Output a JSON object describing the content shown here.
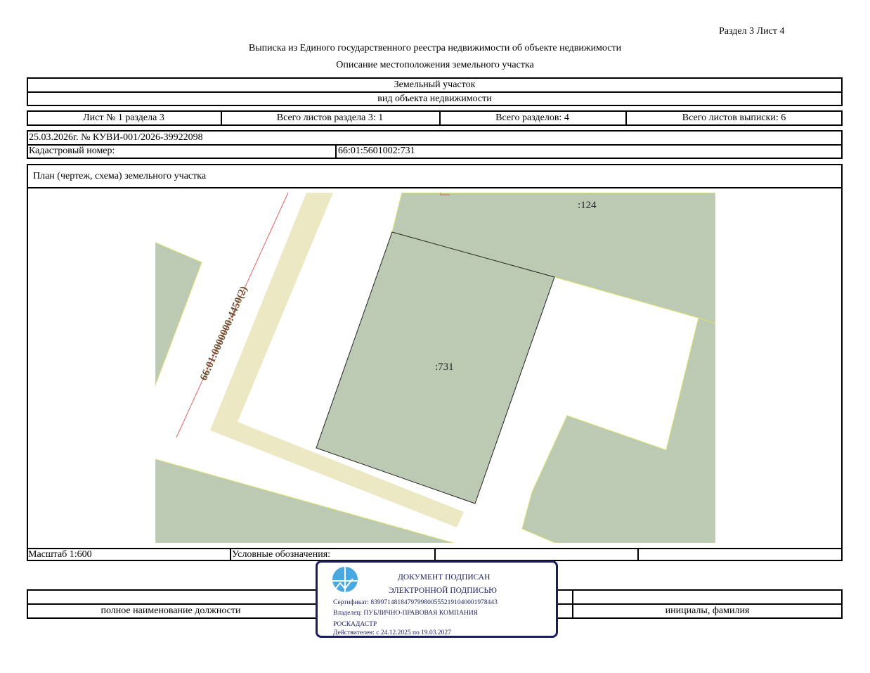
{
  "header": {
    "section_sheet": "Раздел 3    Лист 4",
    "title": "Выписка из Единого государственного реестра недвижимости об объекте недвижимости",
    "subtitle": "Описание местоположения земельного участка"
  },
  "object": {
    "type": "Земельный участок",
    "type_caption": "вид объекта недвижимости"
  },
  "sheet_info": [
    "Лист № 1 раздела 3",
    "Всего листов раздела 3: 1",
    "Всего разделов: 4",
    "Всего листов выписки: 6"
  ],
  "record": {
    "date_number": "25.03.2026г. № КУВИ-001/2026-39922098",
    "cadastral_label": "Кадастровый номер:",
    "cadastral_value": "66:01:5601002:731"
  },
  "plan": {
    "title": "План (чертеж, схема) земельного участка",
    "labels": {
      "parcel_main": ":731",
      "parcel_neighbor": ":124",
      "road": "66:01:0000000:4450(2)"
    },
    "colors": {
      "parcel": "#bccab4",
      "road": "#ede8c4",
      "border_line": "#e06060"
    }
  },
  "footer": {
    "scale": "Масштаб 1:600",
    "legend": "Условные обозначения:",
    "position_caption": "полное наименование должности",
    "name_caption": "инициалы, фамилия"
  },
  "stamp": {
    "line1": "ДОКУМЕНТ ПОДПИСАН",
    "line2": "ЭЛЕКТРОННОЙ ПОДПИСЬЮ",
    "certificate": "Сертификат: 839971481847979980055521910400019784​43",
    "owner": "Владелец: ПУБЛИЧНО-ПРАВОВАЯ КОМПАНИЯ",
    "owner2": "РОСКАДАСТР",
    "valid": "Действителен: с 24.12.2025 по 19.03.2027",
    "color": "#1a1f5c",
    "logo_color": "#4aa8e0"
  }
}
